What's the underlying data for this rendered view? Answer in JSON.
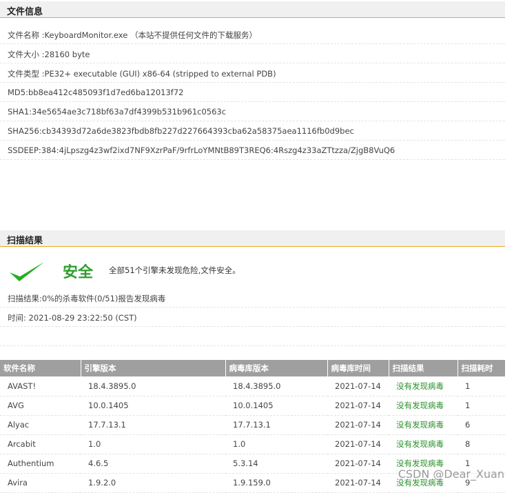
{
  "file_info": {
    "heading": "文件信息",
    "rows": [
      "文件名称 :KeyboardMonitor.exe （本站不提供任何文件的下载服务）",
      "文件大小 :28160 byte",
      "文件类型 :PE32+ executable (GUI) x86-64 (stripped to external PDB)",
      "MD5:bb8ea412c485093f1d7ed6ba12013f72",
      "SHA1:34e5654ae3c718bf63a7df4399b531b961c0563c",
      "SHA256:cb34393d72a6de3823fbdb8fb227d227664393cba62a58375aea1116fb0d9bec",
      "SSDEEP:384:4jLpszg4z3wf2ixd7NF9XzrPaF/9rfrLoYMNtB89T3REQ6:4Rszg4z33aZTtzza/ZjgB8VuQ6"
    ]
  },
  "scan": {
    "heading": "扫描结果",
    "safe_label": "安全",
    "safe_desc": "全部51个引擎未发现危险,文件安全。",
    "result_line": "扫描结果:0%的杀毒软件(0/51)报告发现病毒",
    "time_line": "时间: 2021-08-29 23:22:50 (CST)"
  },
  "table": {
    "headers": [
      "软件名称",
      "引擎版本",
      "病毒库版本",
      "病毒库时间",
      "扫描结果",
      "扫描耗时"
    ],
    "rows": [
      [
        "AVAST!",
        "18.4.3895.0",
        "18.4.3895.0",
        "2021-07-14",
        "没有发现病毒",
        "1"
      ],
      [
        "AVG",
        "10.0.1405",
        "10.0.1405",
        "2021-07-14",
        "没有发现病毒",
        "1"
      ],
      [
        "Alyac",
        "17.7.13.1",
        "17.7.13.1",
        "2021-07-14",
        "没有发现病毒",
        "6"
      ],
      [
        "Arcabit",
        "1.0",
        "1.0",
        "2021-07-14",
        "没有发现病毒",
        "8"
      ],
      [
        "Authentium",
        "4.6.5",
        "5.3.14",
        "2021-07-14",
        "没有发现病毒",
        "1"
      ],
      [
        "Avira",
        "1.9.2.0",
        "1.9.159.0",
        "2021-07-14",
        "没有发现病毒",
        "9"
      ]
    ]
  },
  "watermark": "CSDN @Dear_Xuan",
  "colors": {
    "accent_line": "#e6a820",
    "safe_green": "#2f9c2f",
    "header_gray": "#9f9f9f"
  }
}
